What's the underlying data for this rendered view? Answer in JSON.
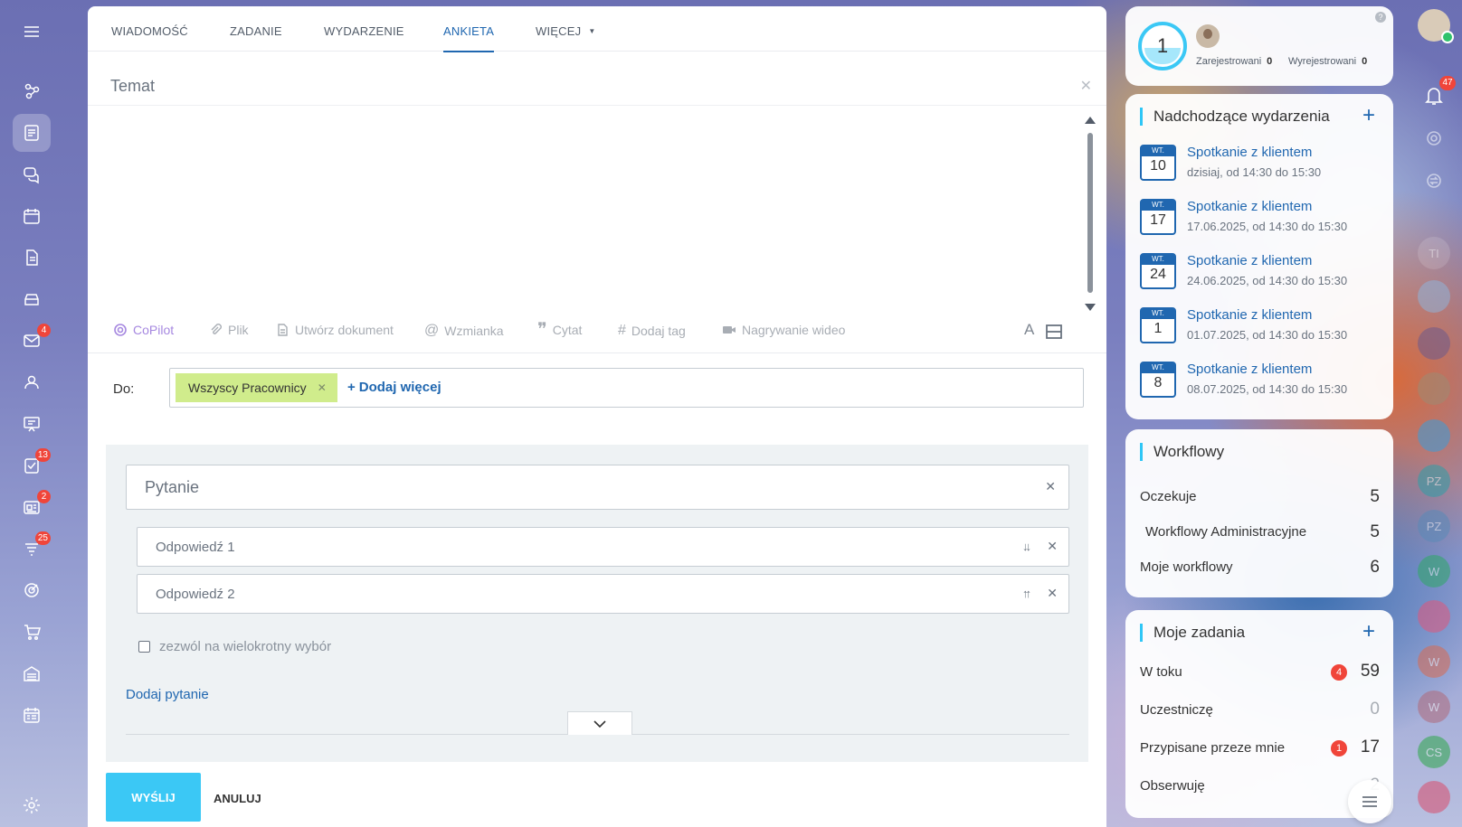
{
  "tabs": [
    {
      "label": "WIADOMOŚĆ"
    },
    {
      "label": "ZADANIE"
    },
    {
      "label": "WYDARZENIE"
    },
    {
      "label": "ANKIETA"
    },
    {
      "label": "WIĘCEJ"
    }
  ],
  "subject": {
    "placeholder": "Temat"
  },
  "toolbar": {
    "items": [
      "CoPilot",
      "Plik",
      "Utwórz dokument",
      "Wzmianka",
      "Cytat",
      "Dodaj tag",
      "Nagrywanie wideo"
    ],
    "font_icon": "A"
  },
  "recipients": {
    "label": "Do:",
    "chip": "Wszyscy Pracownicy",
    "add_more": "Dodaj więcej"
  },
  "poll": {
    "question_placeholder": "Pytanie",
    "answers": [
      "Odpowiedź 1",
      "Odpowiedź 2"
    ],
    "multiple_choice_label": "zezwól na wielokrotny wybór",
    "add_question": "Dodaj pytanie"
  },
  "actions": {
    "send": "WYŚLIJ",
    "cancel": "ANULUJ"
  },
  "left_rail": {
    "badges": {
      "mail": "4",
      "tasks": "13",
      "news": "2",
      "filters": "25"
    }
  },
  "stats": {
    "count": "1",
    "registered_label": "Zarejestrowani",
    "registered_value": "0",
    "unregistered_label": "Wyrejestrowani",
    "unregistered_value": "0"
  },
  "events": {
    "title": "Nadchodzące wydarzenia",
    "items": [
      {
        "weekday": "WT.",
        "day": "10",
        "title": "Spotkanie z klientem",
        "when": "dzisiaj, od 14:30 do 15:30"
      },
      {
        "weekday": "WT.",
        "day": "17",
        "title": "Spotkanie z klientem",
        "when": "17.06.2025, od 14:30 do 15:30"
      },
      {
        "weekday": "WT.",
        "day": "24",
        "title": "Spotkanie z klientem",
        "when": "24.06.2025, od 14:30 do 15:30"
      },
      {
        "weekday": "WT.",
        "day": "1",
        "title": "Spotkanie z klientem",
        "when": "01.07.2025, od 14:30 do 15:30"
      },
      {
        "weekday": "WT.",
        "day": "8",
        "title": "Spotkanie z klientem",
        "when": "08.07.2025, od 14:30 do 15:30"
      }
    ]
  },
  "workflows": {
    "title": "Workflowy",
    "rows": [
      {
        "label": "Oczekuje",
        "value": "5"
      },
      {
        "label": "Workflowy Administracyjne",
        "value": "5"
      },
      {
        "label": "Moje workflowy",
        "value": "6"
      }
    ]
  },
  "tasks": {
    "title": "Moje zadania",
    "rows": [
      {
        "label": "W toku",
        "badge": "4",
        "value": "59"
      },
      {
        "label": "Uczestniczę",
        "value": "0"
      },
      {
        "label": "Przypisane przeze mnie",
        "badge": "1",
        "value": "17"
      },
      {
        "label": "Obserwuję",
        "value": "2"
      }
    ]
  },
  "right_strip": {
    "notifications_badge": "47",
    "avatars": [
      "TI",
      "PZ",
      "PZ",
      "W",
      "W",
      "W",
      "CS"
    ]
  },
  "colors": {
    "accent": "#2067b0",
    "send_button": "#3bc8f5",
    "chip": "#d0ec8c",
    "badge": "#f0453a"
  }
}
